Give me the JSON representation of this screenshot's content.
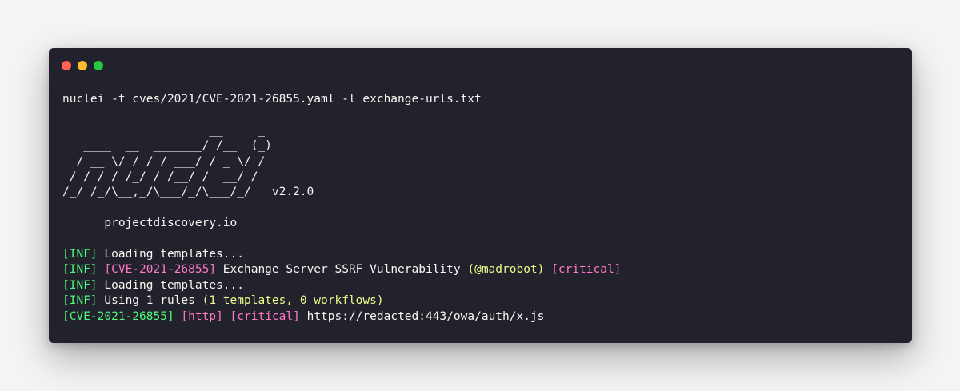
{
  "colors": {
    "background": "#21222c",
    "text": "#f8f8f2",
    "green": "#50fa7b",
    "pink": "#ff79c6",
    "yellow": "#f1fa8c",
    "close_dot": "#ff5f56",
    "minimize_dot": "#ffbd2e",
    "maximize_dot": "#27c93f"
  },
  "window_controls": {
    "icons": [
      "close-dot-icon",
      "minimize-dot-icon",
      "maximize-dot-icon"
    ]
  },
  "command": "nuclei -t cves/2021/CVE-2021-26855.yaml -l exchange-urls.txt",
  "banner": {
    "ascii_art": "                     __     _\n   ____  __  _______/ /__  (_)\n  / __ \\/ / / / ___/ / _ \\/ /\n / / / / /_/ / /__/ /  __/ /\n/_/ /_/\\__,_/\\___/_/\\___/_/   v2.2.0",
    "site": "      projectdiscovery.io"
  },
  "output": {
    "line1": {
      "tag": "[INF]",
      "text": " Loading templates..."
    },
    "line2": {
      "tag": "[INF]",
      "cve": "[CVE-2021-26855]",
      "title": " Exchange Server SSRF Vulnerability ",
      "author": "(@madrobot)",
      "severity": "[critical]"
    },
    "line3": {
      "tag": "[INF]",
      "text": " Loading templates..."
    },
    "line4": {
      "tag": "[INF]",
      "text": " Using 1 rules ",
      "detail": "(1 templates, 0 workflows)"
    },
    "line5": {
      "cve": "[CVE-2021-26855]",
      "protocol": "[http]",
      "severity": "[critical]",
      "url": "https://redacted:443/owa/auth/x.js"
    }
  }
}
